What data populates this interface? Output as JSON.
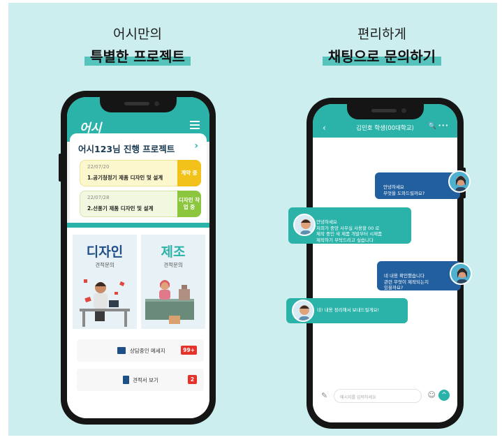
{
  "left_caption": {
    "line1": "어시만의",
    "line2": "특별한 프로젝트"
  },
  "right_caption": {
    "line1": "편리하게",
    "line2": "채팅으로 문의하기"
  },
  "left_phone": {
    "logo": "어시",
    "project_section": {
      "title": "어시123님 진행 프로젝트",
      "chevron": "›",
      "items": [
        {
          "date": "22/07/20",
          "name": "1.공기청정기 제품 디자인 및 설계",
          "badge": "계약 중"
        },
        {
          "date": "22/07/28",
          "name": "2.선풍기 제품 디자인 및 설계",
          "badge": "디자인 작업 중"
        }
      ]
    },
    "categories": [
      {
        "title": "디자인",
        "subtitle": "견적문의",
        "color": "#1e4f86"
      },
      {
        "title": "제조",
        "subtitle": "견적문의",
        "color": "#2bb3aa"
      }
    ],
    "menu": [
      {
        "label": "상담중인 메세지",
        "badge": "99+"
      },
      {
        "label": "견적서 보기",
        "badge": "2"
      }
    ]
  },
  "right_phone": {
    "header": {
      "back": "‹",
      "title": "김민호 학생(00대학교)",
      "search": "🔍",
      "more": "···"
    },
    "messages": [
      {
        "side": "user",
        "text": "안녕하세요\n무엇을 도와드릴까요?"
      },
      {
        "side": "agent",
        "text": "안녕하세요\n저희가 중앙 사무실 사용할 00 로\n제작 중인 새 제품 개발부터 시제품\n제작하기 부탁드리고 싶습니다"
      },
      {
        "side": "user",
        "text": "네 내용 확인했습니다\n관련 무엇이 제작되는지\n있을까요?"
      },
      {
        "side": "agent",
        "text": "네! 내용 정리해서 보내드릴게요!"
      }
    ],
    "input_placeholder": "메시지를 입력하세요",
    "attach_icon": "✎",
    "emoji_icon": "☺",
    "send_icon": "^"
  },
  "colors": {
    "background": "#cdeeee",
    "teal": "#2bb3aa",
    "navy": "#1e4f86",
    "badge_red": "#e5322b",
    "yellow": "#f2c21b",
    "green": "#8cc63f"
  }
}
